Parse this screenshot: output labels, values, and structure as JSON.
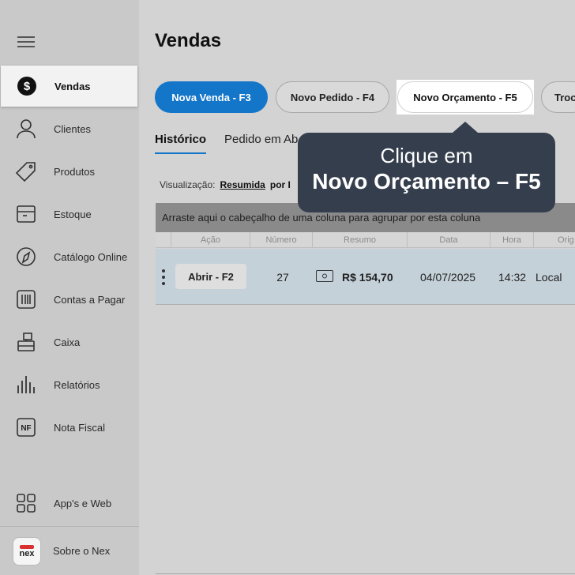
{
  "sidebar": {
    "items": [
      {
        "label": "Vendas",
        "icon": "dollar-coin-icon"
      },
      {
        "label": "Clientes",
        "icon": "person-icon"
      },
      {
        "label": "Produtos",
        "icon": "tag-icon"
      },
      {
        "label": "Estoque",
        "icon": "box-icon"
      },
      {
        "label": "Catálogo Online",
        "icon": "catalog-icon"
      },
      {
        "label": "Contas a Pagar",
        "icon": "barcode-icon"
      },
      {
        "label": "Caixa",
        "icon": "cash-register-icon"
      },
      {
        "label": "Relatórios",
        "icon": "bar-report-icon"
      },
      {
        "label": "Nota Fiscal",
        "icon": "nf-icon"
      },
      {
        "label": "App's e Web",
        "icon": "apps-grid-icon"
      },
      {
        "label": "Sobre o Nex",
        "icon": "nex-logo-icon"
      }
    ],
    "logo_text": "nex"
  },
  "main": {
    "title": "Vendas",
    "actions": [
      "Nova Venda - F3",
      "Novo Pedido - F4",
      "Novo Orçamento - F5",
      "Troc"
    ],
    "tabs": [
      "Histórico",
      "Pedido em Ab"
    ],
    "view_label": "Visualização:",
    "view_option": "Resumida",
    "view_option2": "por I",
    "group_hint": "Arraste aqui o cabeçalho de uma coluna para agrupar por esta coluna",
    "columns": [
      "Ação",
      "Número",
      "Resumo",
      "Data",
      "Hora",
      "Orig"
    ],
    "rows": [
      {
        "action": "Abrir - F2",
        "number": "27",
        "summary": "R$ 154,70",
        "date": "04/07/2025",
        "time": "14:32",
        "origin": "Local"
      }
    ]
  },
  "tooltip": {
    "line1": "Clique em",
    "line2": "Novo Orçamento – F5"
  },
  "colors": {
    "accent": "#1476c9",
    "tooltip_bg": "#343e4d",
    "row_bg": "#c5d1d9"
  }
}
